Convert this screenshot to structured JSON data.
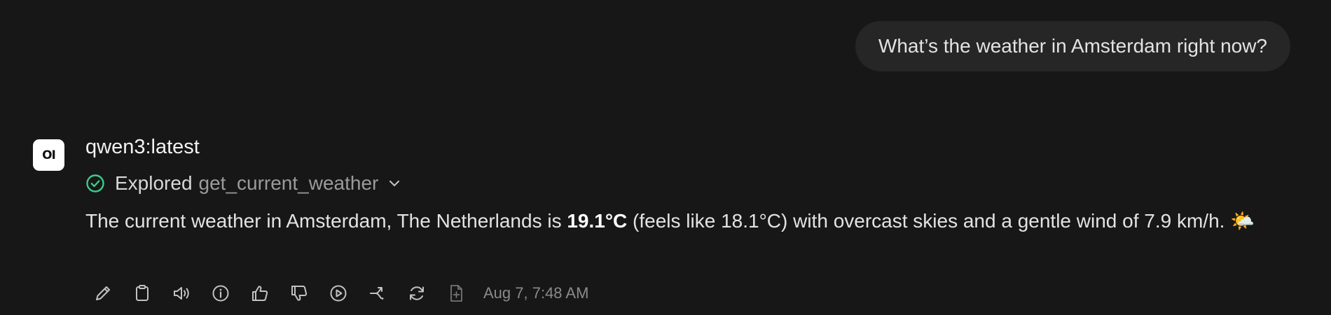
{
  "user_message": {
    "text": "What’s the weather in Amsterdam right now?"
  },
  "assistant": {
    "avatar_text": "OI",
    "model_name": "qwen3:latest",
    "tool_call": {
      "status": "Explored",
      "name": "get_current_weather",
      "icon": "check-circle-icon"
    },
    "response": {
      "part1": "The current weather in Amsterdam, The Netherlands is ",
      "temperature": "19.1°C",
      "part2": " (feels like 18.1°C) with overcast skies and a gentle wind of 7.9 km/h. ",
      "emoji": "🌤️"
    },
    "actions": [
      {
        "icon": "pencil-icon",
        "label": "Edit"
      },
      {
        "icon": "clipboard-icon",
        "label": "Copy"
      },
      {
        "icon": "speaker-icon",
        "label": "Read Aloud"
      },
      {
        "icon": "info-icon",
        "label": "Generation Info"
      },
      {
        "icon": "thumbs-up-icon",
        "label": "Good Response"
      },
      {
        "icon": "thumbs-down-icon",
        "label": "Bad Response"
      },
      {
        "icon": "play-circle-icon",
        "label": "Continue Response"
      },
      {
        "icon": "branch-icon",
        "label": "Regenerate"
      },
      {
        "icon": "refresh-icon",
        "label": "Regenerate"
      },
      {
        "icon": "add-file-icon",
        "label": "Add Note"
      }
    ],
    "timestamp": "Aug 7, 7:48 AM"
  },
  "colors": {
    "background": "#171717",
    "user_bubble": "#262626",
    "check_icon": "#3ec98a",
    "icon_gray": "#c2c2c2"
  }
}
